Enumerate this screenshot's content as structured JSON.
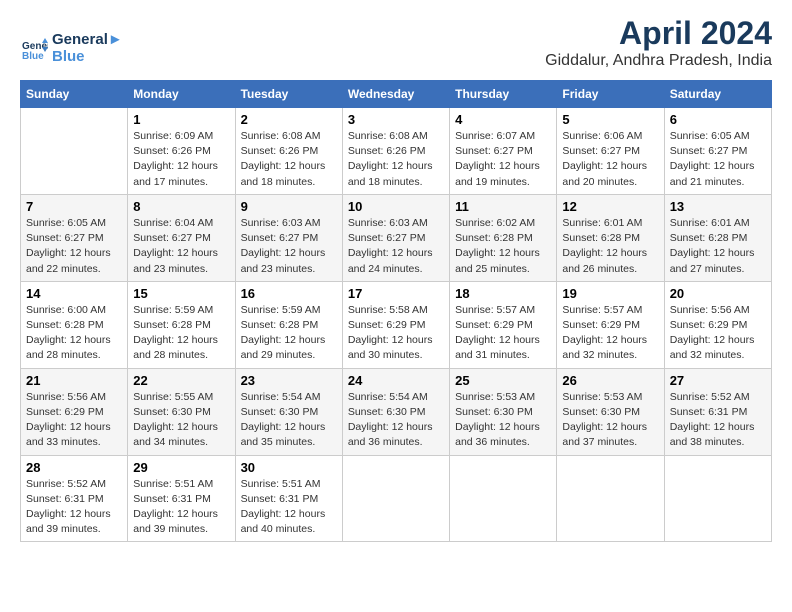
{
  "header": {
    "logo_line1": "General",
    "logo_line2": "Blue",
    "title": "April 2024",
    "subtitle": "Giddalur, Andhra Pradesh, India"
  },
  "calendar": {
    "columns": [
      "Sunday",
      "Monday",
      "Tuesday",
      "Wednesday",
      "Thursday",
      "Friday",
      "Saturday"
    ],
    "weeks": [
      [
        {
          "day": "",
          "info": ""
        },
        {
          "day": "1",
          "info": "Sunrise: 6:09 AM\nSunset: 6:26 PM\nDaylight: 12 hours\nand 17 minutes."
        },
        {
          "day": "2",
          "info": "Sunrise: 6:08 AM\nSunset: 6:26 PM\nDaylight: 12 hours\nand 18 minutes."
        },
        {
          "day": "3",
          "info": "Sunrise: 6:08 AM\nSunset: 6:26 PM\nDaylight: 12 hours\nand 18 minutes."
        },
        {
          "day": "4",
          "info": "Sunrise: 6:07 AM\nSunset: 6:27 PM\nDaylight: 12 hours\nand 19 minutes."
        },
        {
          "day": "5",
          "info": "Sunrise: 6:06 AM\nSunset: 6:27 PM\nDaylight: 12 hours\nand 20 minutes."
        },
        {
          "day": "6",
          "info": "Sunrise: 6:05 AM\nSunset: 6:27 PM\nDaylight: 12 hours\nand 21 minutes."
        }
      ],
      [
        {
          "day": "7",
          "info": "Sunrise: 6:05 AM\nSunset: 6:27 PM\nDaylight: 12 hours\nand 22 minutes."
        },
        {
          "day": "8",
          "info": "Sunrise: 6:04 AM\nSunset: 6:27 PM\nDaylight: 12 hours\nand 23 minutes."
        },
        {
          "day": "9",
          "info": "Sunrise: 6:03 AM\nSunset: 6:27 PM\nDaylight: 12 hours\nand 23 minutes."
        },
        {
          "day": "10",
          "info": "Sunrise: 6:03 AM\nSunset: 6:27 PM\nDaylight: 12 hours\nand 24 minutes."
        },
        {
          "day": "11",
          "info": "Sunrise: 6:02 AM\nSunset: 6:28 PM\nDaylight: 12 hours\nand 25 minutes."
        },
        {
          "day": "12",
          "info": "Sunrise: 6:01 AM\nSunset: 6:28 PM\nDaylight: 12 hours\nand 26 minutes."
        },
        {
          "day": "13",
          "info": "Sunrise: 6:01 AM\nSunset: 6:28 PM\nDaylight: 12 hours\nand 27 minutes."
        }
      ],
      [
        {
          "day": "14",
          "info": "Sunrise: 6:00 AM\nSunset: 6:28 PM\nDaylight: 12 hours\nand 28 minutes."
        },
        {
          "day": "15",
          "info": "Sunrise: 5:59 AM\nSunset: 6:28 PM\nDaylight: 12 hours\nand 28 minutes."
        },
        {
          "day": "16",
          "info": "Sunrise: 5:59 AM\nSunset: 6:28 PM\nDaylight: 12 hours\nand 29 minutes."
        },
        {
          "day": "17",
          "info": "Sunrise: 5:58 AM\nSunset: 6:29 PM\nDaylight: 12 hours\nand 30 minutes."
        },
        {
          "day": "18",
          "info": "Sunrise: 5:57 AM\nSunset: 6:29 PM\nDaylight: 12 hours\nand 31 minutes."
        },
        {
          "day": "19",
          "info": "Sunrise: 5:57 AM\nSunset: 6:29 PM\nDaylight: 12 hours\nand 32 minutes."
        },
        {
          "day": "20",
          "info": "Sunrise: 5:56 AM\nSunset: 6:29 PM\nDaylight: 12 hours\nand 32 minutes."
        }
      ],
      [
        {
          "day": "21",
          "info": "Sunrise: 5:56 AM\nSunset: 6:29 PM\nDaylight: 12 hours\nand 33 minutes."
        },
        {
          "day": "22",
          "info": "Sunrise: 5:55 AM\nSunset: 6:30 PM\nDaylight: 12 hours\nand 34 minutes."
        },
        {
          "day": "23",
          "info": "Sunrise: 5:54 AM\nSunset: 6:30 PM\nDaylight: 12 hours\nand 35 minutes."
        },
        {
          "day": "24",
          "info": "Sunrise: 5:54 AM\nSunset: 6:30 PM\nDaylight: 12 hours\nand 36 minutes."
        },
        {
          "day": "25",
          "info": "Sunrise: 5:53 AM\nSunset: 6:30 PM\nDaylight: 12 hours\nand 36 minutes."
        },
        {
          "day": "26",
          "info": "Sunrise: 5:53 AM\nSunset: 6:30 PM\nDaylight: 12 hours\nand 37 minutes."
        },
        {
          "day": "27",
          "info": "Sunrise: 5:52 AM\nSunset: 6:31 PM\nDaylight: 12 hours\nand 38 minutes."
        }
      ],
      [
        {
          "day": "28",
          "info": "Sunrise: 5:52 AM\nSunset: 6:31 PM\nDaylight: 12 hours\nand 39 minutes."
        },
        {
          "day": "29",
          "info": "Sunrise: 5:51 AM\nSunset: 6:31 PM\nDaylight: 12 hours\nand 39 minutes."
        },
        {
          "day": "30",
          "info": "Sunrise: 5:51 AM\nSunset: 6:31 PM\nDaylight: 12 hours\nand 40 minutes."
        },
        {
          "day": "",
          "info": ""
        },
        {
          "day": "",
          "info": ""
        },
        {
          "day": "",
          "info": ""
        },
        {
          "day": "",
          "info": ""
        }
      ]
    ]
  }
}
